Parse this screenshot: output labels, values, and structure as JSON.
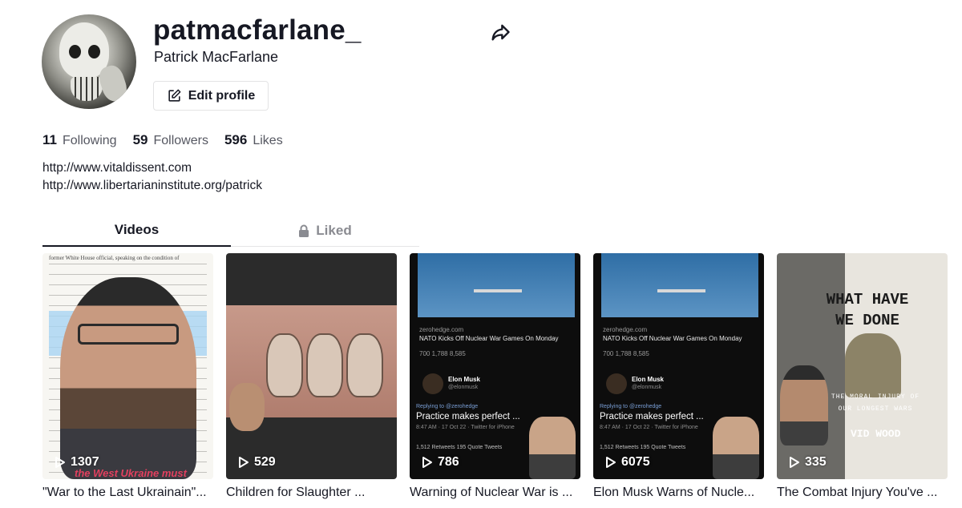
{
  "profile": {
    "username": "patmacfarlane_",
    "full_name": "Patrick MacFarlane",
    "edit_label": "Edit profile"
  },
  "stats": [
    {
      "value": "11",
      "label": "Following"
    },
    {
      "value": "59",
      "label": "Followers"
    },
    {
      "value": "596",
      "label": "Likes"
    }
  ],
  "bio_links": [
    "http://www.vitaldissent.com",
    "http://www.libertarianinstitute.org/patrick"
  ],
  "tabs": [
    {
      "label": "Videos",
      "active": true
    },
    {
      "label": "Liked",
      "active": false,
      "icon": "lock-icon"
    }
  ],
  "videos": [
    {
      "plays": "1307",
      "caption": "\"War to the Last Ukrainain\"..."
    },
    {
      "plays": "529",
      "caption": "Children for Slaughter ..."
    },
    {
      "plays": "786",
      "caption": "Warning of Nuclear War is ..."
    },
    {
      "plays": "6075",
      "caption": "Elon Musk Warns of Nucle..."
    },
    {
      "plays": "335",
      "caption": "The Combat Injury You've ..."
    }
  ],
  "thumb_text": {
    "t1_doc_top": "former White House official, speaking on the condition of",
    "t1_overlay": "the West Ukraine must",
    "tweet_source": "zerohedge.com",
    "tweet_headline": "NATO Kicks Off Nuclear War Games On Monday",
    "tweet_counts": "700   1,788   8,585",
    "tweet_author": "Elon Musk",
    "tweet_handle": "@elonmusk",
    "tweet_reply": "Replying to @zerohedge",
    "tweet_text": "Practice makes perfect ...",
    "tweet_meta": "8:47 AM · 17 Oct 22 · Twitter for iPhone",
    "tweet_rt": "1,512 Retweets   195 Quote Tweets",
    "book_title": "WHAT HAVE WE DONE",
    "book_subtitle": "THE MORAL INJURY OF OUR LONGEST WARS",
    "book_author": "VID WOOD"
  },
  "icons": {
    "share": "share-arrow-icon",
    "edit": "edit-square-icon",
    "lock": "lock-icon",
    "play": "play-icon"
  }
}
